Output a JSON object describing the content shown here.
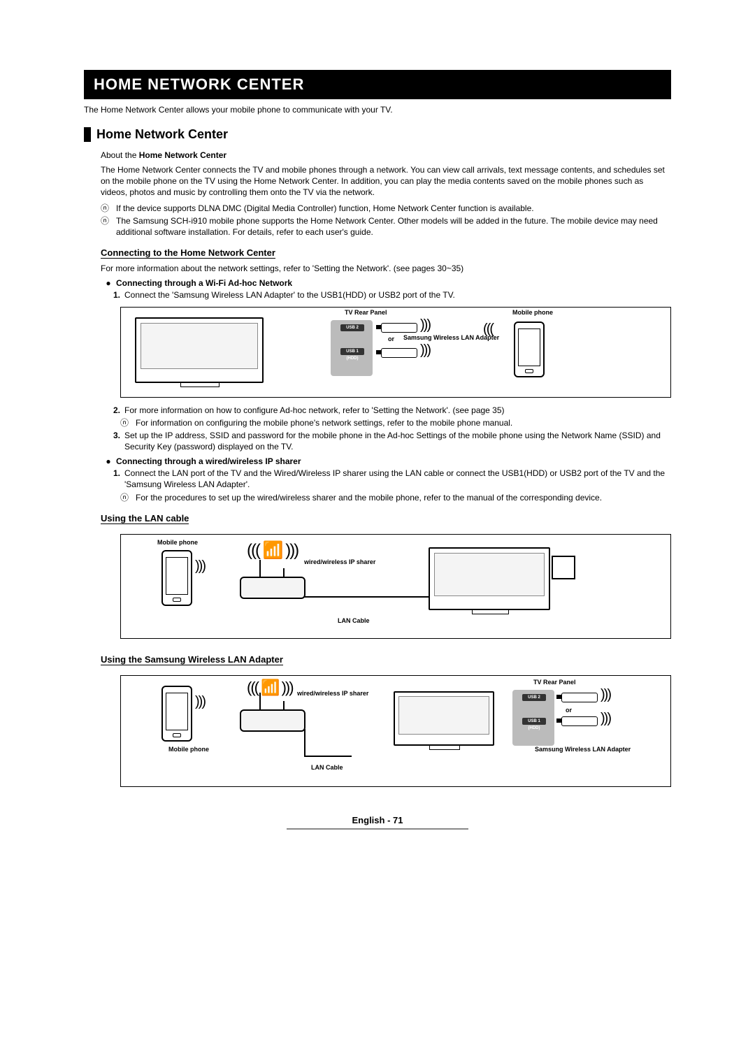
{
  "title_bar": "Home Network Center",
  "intro": "The Home Network Center allows your mobile phone to communicate with your TV.",
  "section_heading": "Home Network Center",
  "about_label": "About the Home Network Center",
  "about_para": "The Home Network Center connects the TV and mobile phones through a network. You can view call arrivals, text message contents, and schedules set on the mobile phone on the TV using the Home Network Center. In addition, you can play the media contents saved on the mobile phones such as videos, photos and music by controlling them onto the TV via the network.",
  "note1": "If the device supports DLNA DMC (Digital Media Controller) function, Home Network Center function is available.",
  "note2": "The Samsung SCH-i910 mobile phone supports the Home Network Center. Other models will be added in the future. The mobile device may need additional software installation. For details, refer to each user's guide.",
  "connecting_heading": "Connecting to the Home Network Center",
  "connecting_para": "For more information about the network settings, refer to 'Setting the Network'. (see pages 30~35)",
  "bullet_adhoc": "Connecting through a Wi-Fi Ad-hoc Network",
  "step1": "Connect the 'Samsung Wireless LAN Adapter' to the USB1(HDD) or USB2 port of the TV.",
  "step2": "For more information on how to configure Ad-hoc network, refer to 'Setting the Network'. (see page 35)",
  "step2_note": "For information on configuring the mobile phone's network settings, refer to the mobile phone manual.",
  "step3": "Set up the IP address, SSID and password for the mobile phone in the Ad-hoc Settings of the mobile phone using the Network Name (SSID) and Security Key (password) displayed on the TV.",
  "bullet_sharer": "Connecting through a wired/wireless IP sharer",
  "sharer_step1": "Connect the LAN port of the TV and the Wired/Wireless IP sharer using the LAN cable or connect the USB1(HDD) or USB2 port of the TV and the 'Samsung Wireless LAN Adapter'.",
  "sharer_note": "For the procedures to set up the wired/wireless sharer and the mobile phone, refer to the manual of the corresponding device.",
  "using_lan_heading": "Using the LAN cable",
  "using_adapter_heading": "Using the Samsung Wireless LAN Adapter",
  "diagram1": {
    "tv_rear_panel": "TV Rear Panel",
    "mobile_phone": "Mobile phone",
    "or": "or",
    "adapter": "Samsung Wireless LAN Adapter",
    "usb2": "USB 2",
    "usb1": "USB 1 (HDD)"
  },
  "diagram2": {
    "mobile_phone": "Mobile phone",
    "sharer": "wired/wireless IP sharer",
    "lan_cable": "LAN Cable"
  },
  "diagram3": {
    "mobile_phone": "Mobile phone",
    "sharer": "wired/wireless IP sharer",
    "lan_cable": "LAN Cable",
    "tv_rear_panel": "TV Rear Panel",
    "or": "or",
    "adapter": "Samsung Wireless LAN Adapter",
    "usb2": "USB 2",
    "usb1": "USB 1 (HDD)"
  },
  "footer": "English - 71",
  "note_symbol": "ⓝ"
}
